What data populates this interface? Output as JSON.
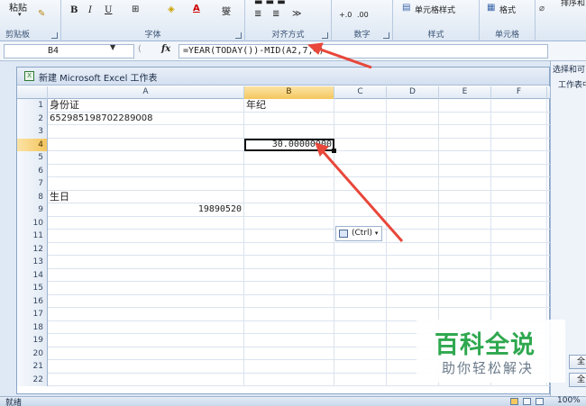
{
  "ribbon": {
    "clipboard_label": "剪贴板",
    "paste_label": "粘贴",
    "font_label": "字体",
    "bold": "B",
    "italic": "I",
    "underline": "U",
    "phonetic": "燮",
    "align_label": "对齐方式",
    "number_label": "数字",
    "inc_decimal": "+.0",
    "dec_decimal": ".00",
    "styles_label": "样式",
    "cell_styles": "单元格样式",
    "cells_label": "单元格",
    "format": "格式",
    "sort": "排序和"
  },
  "formula_bar": {
    "name_box": "B4",
    "fx": "fx",
    "formula": "=YEAR(TODAY())-MID(A2,7,4)"
  },
  "workbook": {
    "title": "新建 Microsoft Excel 工作表",
    "columns": [
      "A",
      "B",
      "C",
      "D",
      "E",
      "F"
    ],
    "rows": [
      "1",
      "2",
      "3",
      "4",
      "5",
      "6",
      "7",
      "8",
      "9",
      "10",
      "11",
      "12",
      "13",
      "14",
      "15",
      "16",
      "17",
      "18",
      "19",
      "20",
      "21",
      "22"
    ],
    "cells": {
      "A1": "身份证",
      "B1": "年纪",
      "A2": "652985198702289008",
      "B4": "30.00000000",
      "A8": "生日",
      "A9": "19890520"
    },
    "paste_options": "(Ctrl)"
  },
  "task_pane": {
    "title": "选择和可",
    "subtitle": "工作表中",
    "btn1": "全",
    "btn2": "全"
  },
  "status": {
    "ready": "就绪",
    "zoom": "100%"
  },
  "watermark": {
    "big": "百科全说",
    "small": "助你轻松解决"
  },
  "colors": {
    "accent_arrow": "#e8473a",
    "selected_header": "#f4c65e",
    "watermark_green": "#2fa84f"
  }
}
